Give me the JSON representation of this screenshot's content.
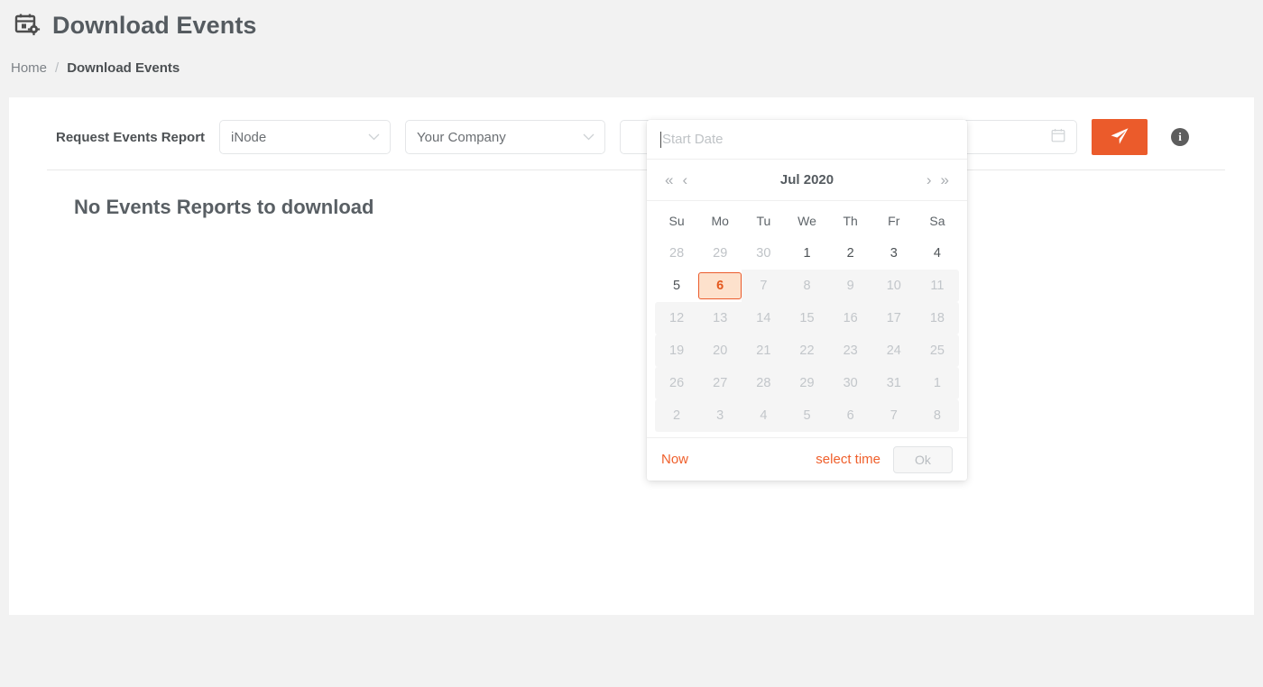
{
  "header": {
    "title": "Download Events",
    "title_icon": "calendar-settings-icon"
  },
  "breadcrumb": {
    "home": "Home",
    "separator": "/",
    "current": "Download Events"
  },
  "form": {
    "label": "Request Events Report",
    "node_select": {
      "value": "iNode",
      "icon": "chevron-down-icon"
    },
    "company_select": {
      "value": "Your Company",
      "icon": "chevron-down-icon"
    },
    "range_input": {
      "value": "",
      "placeholder": "",
      "icon": "calendar-icon"
    },
    "send_button": {
      "icon": "send-icon",
      "color": "#eb5b2b"
    },
    "info_button": {
      "icon": "info-icon",
      "glyph": "i"
    }
  },
  "content": {
    "empty_message": "No Events Reports to download"
  },
  "datepicker": {
    "input_placeholder": "Start Date",
    "nav": {
      "prev_year": "«",
      "prev_month": "‹",
      "next_month": "›",
      "next_year": "»"
    },
    "month_label": "Jul 2020",
    "weekdays": [
      "Su",
      "Mo",
      "Tu",
      "We",
      "Th",
      "Fr",
      "Sa"
    ],
    "weeks": [
      [
        {
          "d": "28",
          "state": "muted"
        },
        {
          "d": "29",
          "state": "muted"
        },
        {
          "d": "30",
          "state": "muted"
        },
        {
          "d": "1",
          "state": "normal"
        },
        {
          "d": "2",
          "state": "normal"
        },
        {
          "d": "3",
          "state": "normal"
        },
        {
          "d": "4",
          "state": "normal"
        }
      ],
      [
        {
          "d": "5",
          "state": "normal"
        },
        {
          "d": "6",
          "state": "today"
        },
        {
          "d": "7",
          "state": "disabled"
        },
        {
          "d": "8",
          "state": "disabled"
        },
        {
          "d": "9",
          "state": "disabled"
        },
        {
          "d": "10",
          "state": "disabled"
        },
        {
          "d": "11",
          "state": "disabled"
        }
      ],
      [
        {
          "d": "12",
          "state": "disabled"
        },
        {
          "d": "13",
          "state": "disabled"
        },
        {
          "d": "14",
          "state": "disabled"
        },
        {
          "d": "15",
          "state": "disabled"
        },
        {
          "d": "16",
          "state": "disabled"
        },
        {
          "d": "17",
          "state": "disabled"
        },
        {
          "d": "18",
          "state": "disabled"
        }
      ],
      [
        {
          "d": "19",
          "state": "disabled"
        },
        {
          "d": "20",
          "state": "disabled"
        },
        {
          "d": "21",
          "state": "disabled"
        },
        {
          "d": "22",
          "state": "disabled"
        },
        {
          "d": "23",
          "state": "disabled"
        },
        {
          "d": "24",
          "state": "disabled"
        },
        {
          "d": "25",
          "state": "disabled"
        }
      ],
      [
        {
          "d": "26",
          "state": "disabled"
        },
        {
          "d": "27",
          "state": "disabled"
        },
        {
          "d": "28",
          "state": "disabled"
        },
        {
          "d": "29",
          "state": "disabled"
        },
        {
          "d": "30",
          "state": "disabled"
        },
        {
          "d": "31",
          "state": "disabled"
        },
        {
          "d": "1",
          "state": "disabled"
        }
      ],
      [
        {
          "d": "2",
          "state": "disabled"
        },
        {
          "d": "3",
          "state": "disabled"
        },
        {
          "d": "4",
          "state": "disabled"
        },
        {
          "d": "5",
          "state": "disabled"
        },
        {
          "d": "6",
          "state": "disabled"
        },
        {
          "d": "7",
          "state": "disabled"
        },
        {
          "d": "8",
          "state": "disabled"
        }
      ]
    ],
    "footer": {
      "now": "Now",
      "select_time": "select time",
      "ok": "Ok"
    }
  },
  "colors": {
    "accent": "#eb5b2b",
    "today_bg": "#fde1cc",
    "page_bg": "#f2f2f2",
    "card_bg": "#ffffff"
  }
}
